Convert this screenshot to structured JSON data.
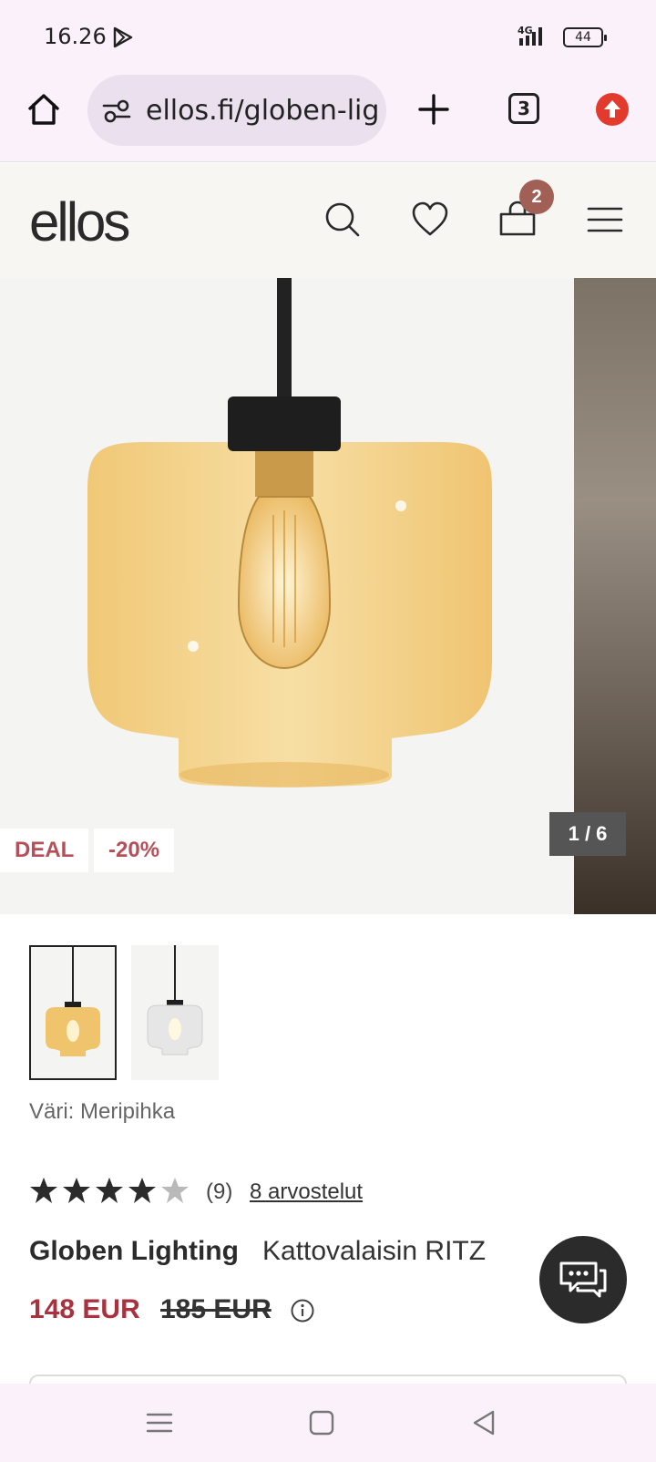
{
  "status": {
    "time": "16.26",
    "network": "4G",
    "battery": "44"
  },
  "browser": {
    "url": "ellos.fi/globen-lig",
    "tab_count": "3"
  },
  "header": {
    "logo": "ellos",
    "cart_count": "2"
  },
  "hero": {
    "badge_deal": "DEAL",
    "badge_discount": "-20%",
    "counter": "1 / 6"
  },
  "product": {
    "color_label": "Väri: Meripihka",
    "rating_value": 4,
    "rating_max": 5,
    "rating_count": "(9)",
    "reviews_link": "8 arvostelut",
    "brand": "Globen Lighting",
    "name": "Kattovalaisin RITZ",
    "price": "148 EUR",
    "old_price": "185 EUR"
  },
  "colors": {
    "accent_price": "#a8323f",
    "badge_text": "#b5505a",
    "cart_badge": "#a06055"
  }
}
